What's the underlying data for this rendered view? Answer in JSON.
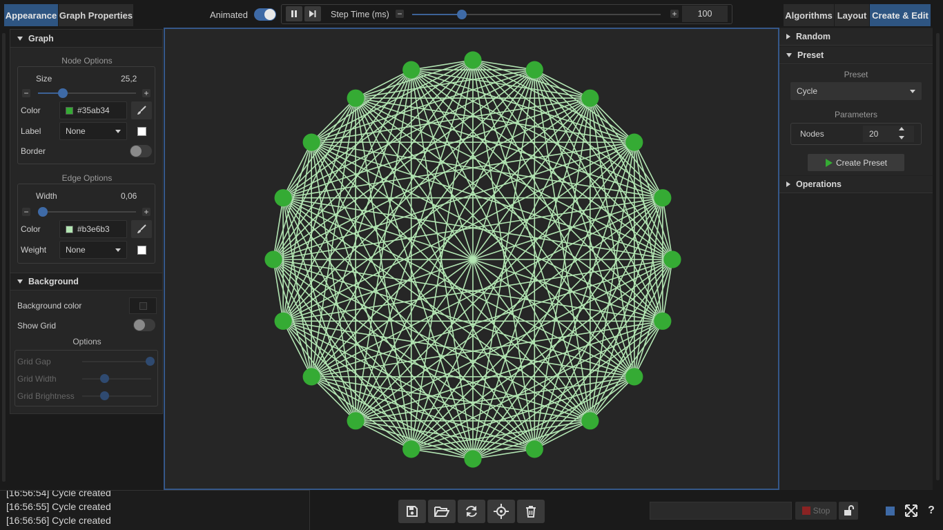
{
  "left_tabs": [
    "Appearance",
    "Graph Properties"
  ],
  "right_tabs": [
    "Algorithms",
    "Layout",
    "Create & Edit"
  ],
  "toolbar": {
    "animated_label": "Animated",
    "step_time_label": "Step Time (ms)",
    "step_time_value": "100",
    "step_fraction": 0.2
  },
  "graph_section": {
    "title": "Graph",
    "node_options_title": "Node Options",
    "size_label": "Size",
    "size_value": "25,2",
    "size_fraction": 0.25,
    "color_label": "Color",
    "node_color": "#35ab34",
    "label_label": "Label",
    "label_value": "None",
    "border_label": "Border",
    "edge_options_title": "Edge Options",
    "width_label": "Width",
    "width_value": "0,06",
    "width_fraction": 0.05,
    "edge_color_label": "Color",
    "edge_color": "#b3e6b3",
    "weight_label": "Weight",
    "weight_value": "None"
  },
  "background_section": {
    "title": "Background",
    "bg_color_label": "Background color",
    "show_grid_label": "Show Grid",
    "options_title": "Options",
    "grid_gap_label": "Grid Gap",
    "grid_width_label": "Grid Width",
    "grid_brightness_label": "Grid Brightness"
  },
  "right_panel": {
    "random_title": "Random",
    "preset_title": "Preset",
    "preset_sub_label": "Preset",
    "preset_value": "Cycle",
    "parameters_label": "Parameters",
    "nodes_label": "Nodes",
    "nodes_value": "20",
    "create_preset_label": "Create Preset",
    "operations_title": "Operations"
  },
  "graph": {
    "node_count": 20,
    "node_color": "#35ab34",
    "edge_color": "#b3e6b3",
    "canvas_bg": "#262626"
  },
  "log": [
    "[16:56:54] Cycle created",
    "[16:56:55] Cycle created",
    "[16:56:56] Cycle created"
  ],
  "bottom": {
    "stop_label": "Stop",
    "icons": [
      "save-icon",
      "folder-open-icon",
      "refresh-icon",
      "center-icon",
      "trash-icon"
    ]
  }
}
